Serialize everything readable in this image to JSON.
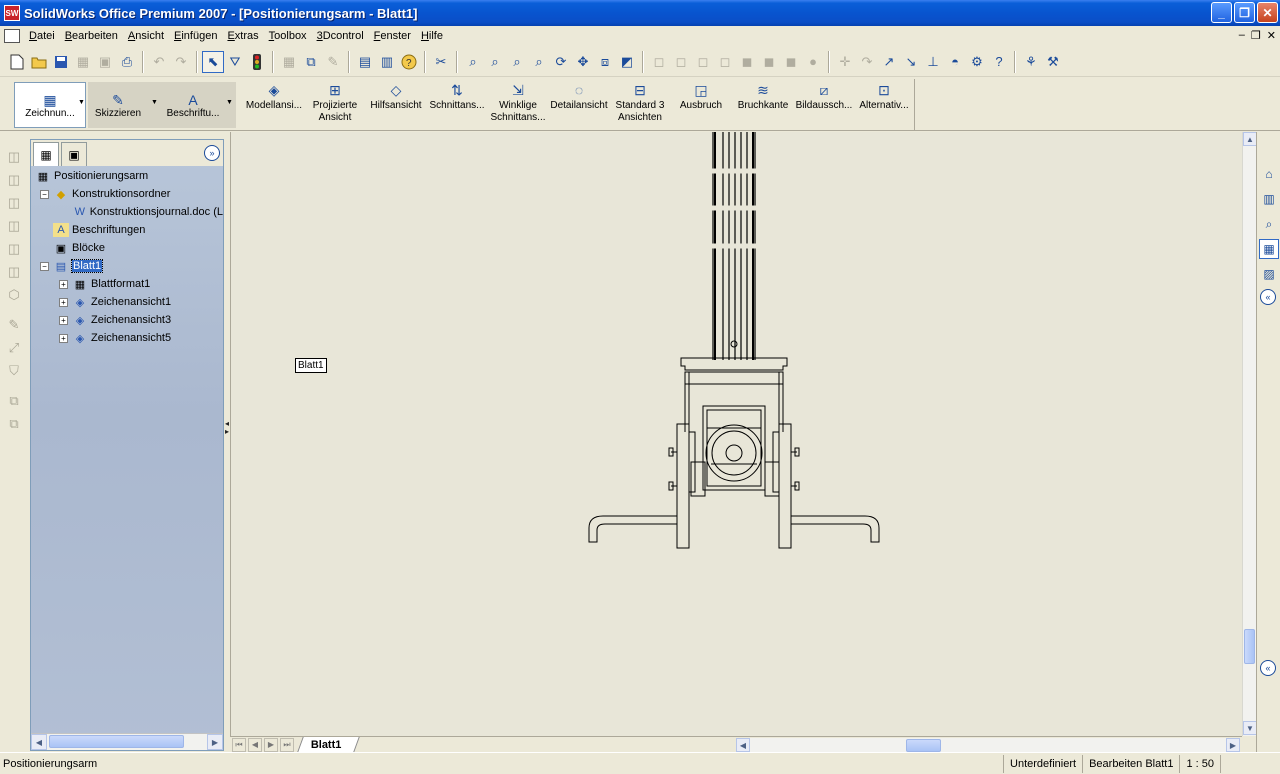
{
  "window": {
    "title": "SolidWorks Office Premium 2007 - [Positionierungsarm - Blatt1]",
    "app_icon": "SW",
    "controls": [
      "_",
      "❐",
      "✕"
    ]
  },
  "menu": {
    "items": [
      {
        "key": "D",
        "rest": "atei"
      },
      {
        "key": "B",
        "rest": "earbeiten"
      },
      {
        "key": "A",
        "rest": "nsicht"
      },
      {
        "key": "E",
        "rest": "infügen"
      },
      {
        "key": "E",
        "rest": "xtras"
      },
      {
        "key": "T",
        "rest": "oolbox"
      },
      {
        "key": "3",
        "rest": "Dcontrol"
      },
      {
        "key": "F",
        "rest": "enster"
      },
      {
        "key": "H",
        "rest": "ilfe"
      }
    ],
    "mdi_controls": [
      "–",
      "❐",
      "✕"
    ]
  },
  "toolbar": {
    "standard": [
      "new-document-icon",
      "open-folder-icon",
      "save-icon",
      "print-preview-icon",
      "undo-icon",
      "redo-icon",
      "select-icon",
      "zoom-to-fit-icon",
      "zoom-area-icon",
      "zoom-in-out-icon",
      "rotate-icon",
      "pan-icon"
    ]
  },
  "command_manager": {
    "tabs": [
      {
        "label": "Zeichnun..."
      },
      {
        "label": "Skizzieren"
      },
      {
        "label": "Beschriftu..."
      }
    ],
    "buttons": [
      {
        "label": "Modellansi..."
      },
      {
        "label": "Projizierte Ansicht"
      },
      {
        "label": "Hilfsansicht"
      },
      {
        "label": "Schnittans..."
      },
      {
        "label": "Winklige Schnittans..."
      },
      {
        "label": "Detailansicht"
      },
      {
        "label": "Standard 3 Ansichten"
      },
      {
        "label": "Ausbruch"
      },
      {
        "label": "Bruchkante"
      },
      {
        "label": "Bildaussch..."
      },
      {
        "label": "Alternativ..."
      }
    ]
  },
  "feature_tree": {
    "root": "Positionierungsarm",
    "items": [
      {
        "label": "Konstruktionsordner",
        "icon": "folder-diamond-icon",
        "expander": "−"
      },
      {
        "label": "Konstruktionsjournal.doc (L",
        "icon": "word-doc-icon",
        "expander": ""
      },
      {
        "label": "Beschriftungen",
        "icon": "annotations-icon",
        "expander": ""
      },
      {
        "label": "Blöcke",
        "icon": "blocks-icon",
        "expander": ""
      },
      {
        "label": "Blatt1",
        "icon": "sheet-icon",
        "expander": "−"
      },
      {
        "label": "Blattformat1",
        "icon": "sheet-format-icon",
        "expander": "+"
      },
      {
        "label": "Zeichenansicht1",
        "icon": "drawing-view-icon",
        "expander": "+"
      },
      {
        "label": "Zeichenansicht3",
        "icon": "drawing-view-icon",
        "expander": "+"
      },
      {
        "label": "Zeichenansicht5",
        "icon": "drawing-view-icon",
        "expander": "+"
      }
    ]
  },
  "canvas": {
    "tooltip": "Blatt1"
  },
  "sheet_tabs": {
    "active": "Blatt1"
  },
  "status": {
    "left": "Positionierungsarm",
    "state": "Unterdefiniert",
    "mode": "Bearbeiten Blatt1",
    "scale": "1 : 50"
  }
}
